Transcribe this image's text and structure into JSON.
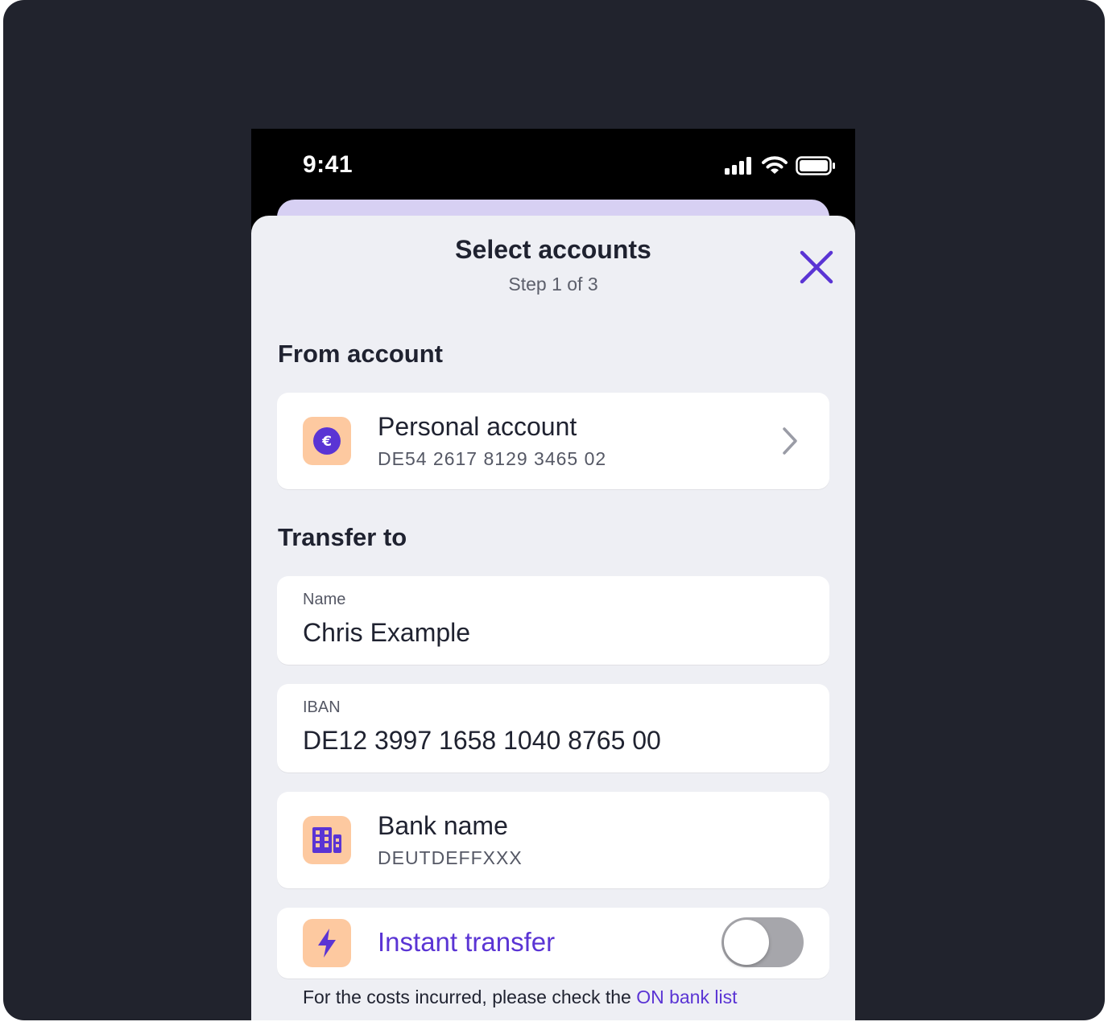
{
  "status_bar": {
    "time": "9:41",
    "icons": [
      "signal-icon",
      "wifi-icon",
      "battery-icon"
    ]
  },
  "sheet": {
    "title": "Select accounts",
    "subtitle": "Step 1 of 3",
    "close_icon": "close-icon"
  },
  "from_section": {
    "heading": "From account",
    "account": {
      "name": "Personal account",
      "iban": "DE54 2617 8129 3465 02",
      "icon": "euro-icon"
    }
  },
  "transfer_section": {
    "heading": "Transfer to",
    "name_field": {
      "label": "Name",
      "value": "Chris Example"
    },
    "iban_field": {
      "label": "IBAN",
      "value": "DE12 3997 1658 1040 8765 00"
    },
    "bank": {
      "name": "Bank name",
      "bic": "DEUTDEFFXXX",
      "icon": "building-icon"
    },
    "instant": {
      "label": "Instant transfer",
      "enabled": false,
      "icon": "lightning-icon"
    }
  },
  "footer": {
    "note": "For the costs incurred, please check the",
    "link": "ON bank list"
  },
  "colors": {
    "backdrop": "#21232d",
    "accent": "#5a34d4",
    "icon_tile": "#fdc9a0",
    "sheet_bg": "#eeeff4",
    "behind_card": "#d7d0f3"
  }
}
